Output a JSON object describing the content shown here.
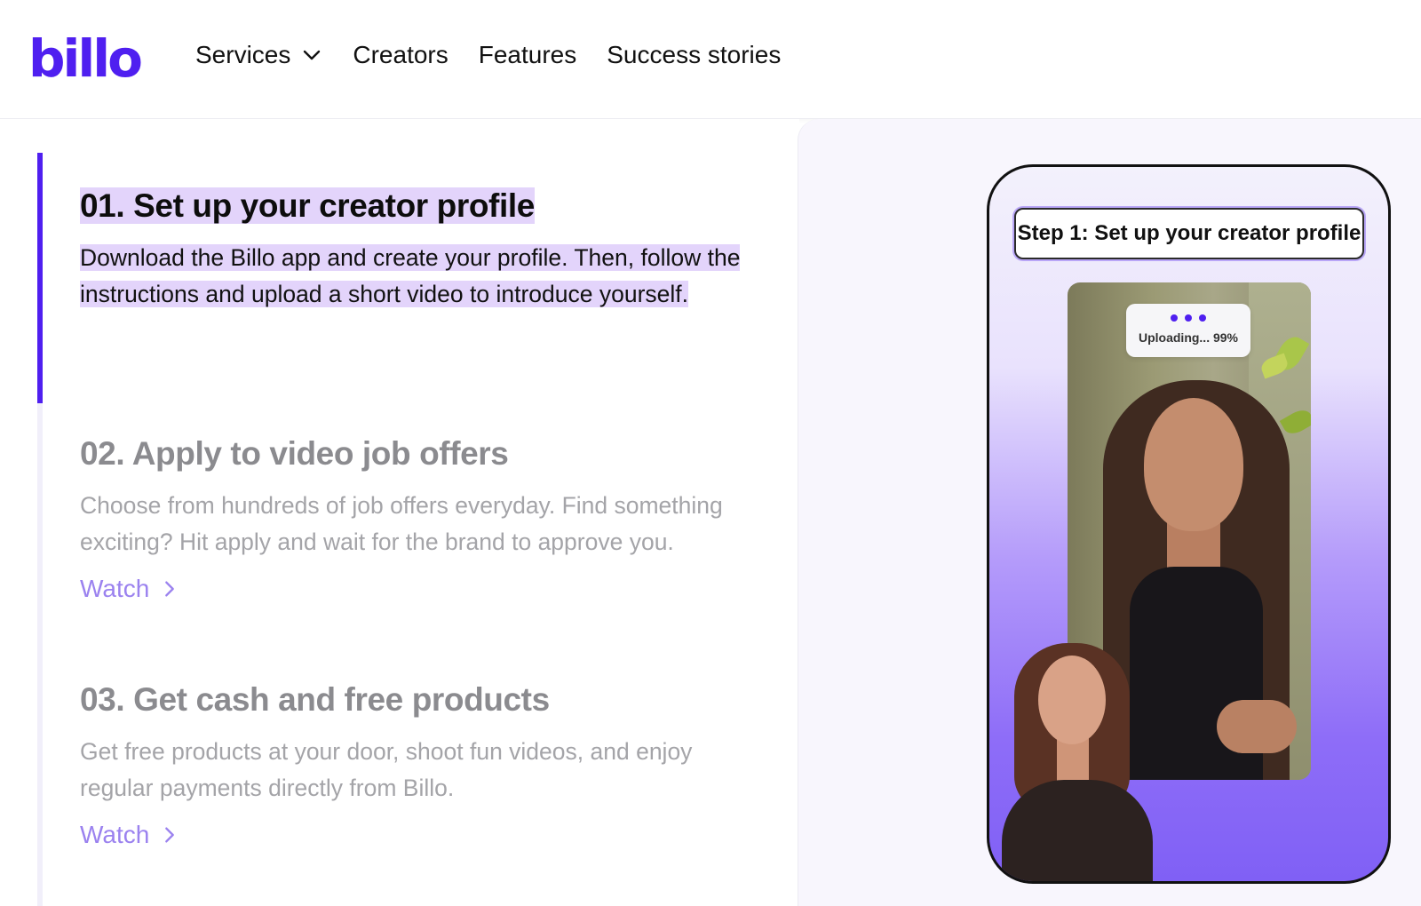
{
  "brand": {
    "logo_text": "billo",
    "accent": "#4f1ff0"
  },
  "nav": {
    "items": [
      {
        "label": "Services",
        "has_dropdown": true
      },
      {
        "label": "Creators"
      },
      {
        "label": "Features"
      },
      {
        "label": "Success stories"
      }
    ]
  },
  "steps": [
    {
      "title": "01. Set up your creator profile",
      "description": "Download the Billo app and create your profile. Then, follow the instructions and upload a short video to introduce yourself.",
      "active": true
    },
    {
      "title": "02. Apply to video job offers",
      "description": "Choose from hundreds of job offers everyday. Find something exciting? Hit apply and wait for the brand to approve you.",
      "watch_label": "Watch",
      "active": false
    },
    {
      "title": "03. Get cash and free products",
      "description": "Get free products at your door, shoot fun videos, and enjoy regular payments directly from Billo.",
      "watch_label": "Watch",
      "active": false
    }
  ],
  "phone": {
    "step_label": "Step 1: Set up your creator profile",
    "upload_status": "Uploading... 99%",
    "progress_percent": 99
  }
}
